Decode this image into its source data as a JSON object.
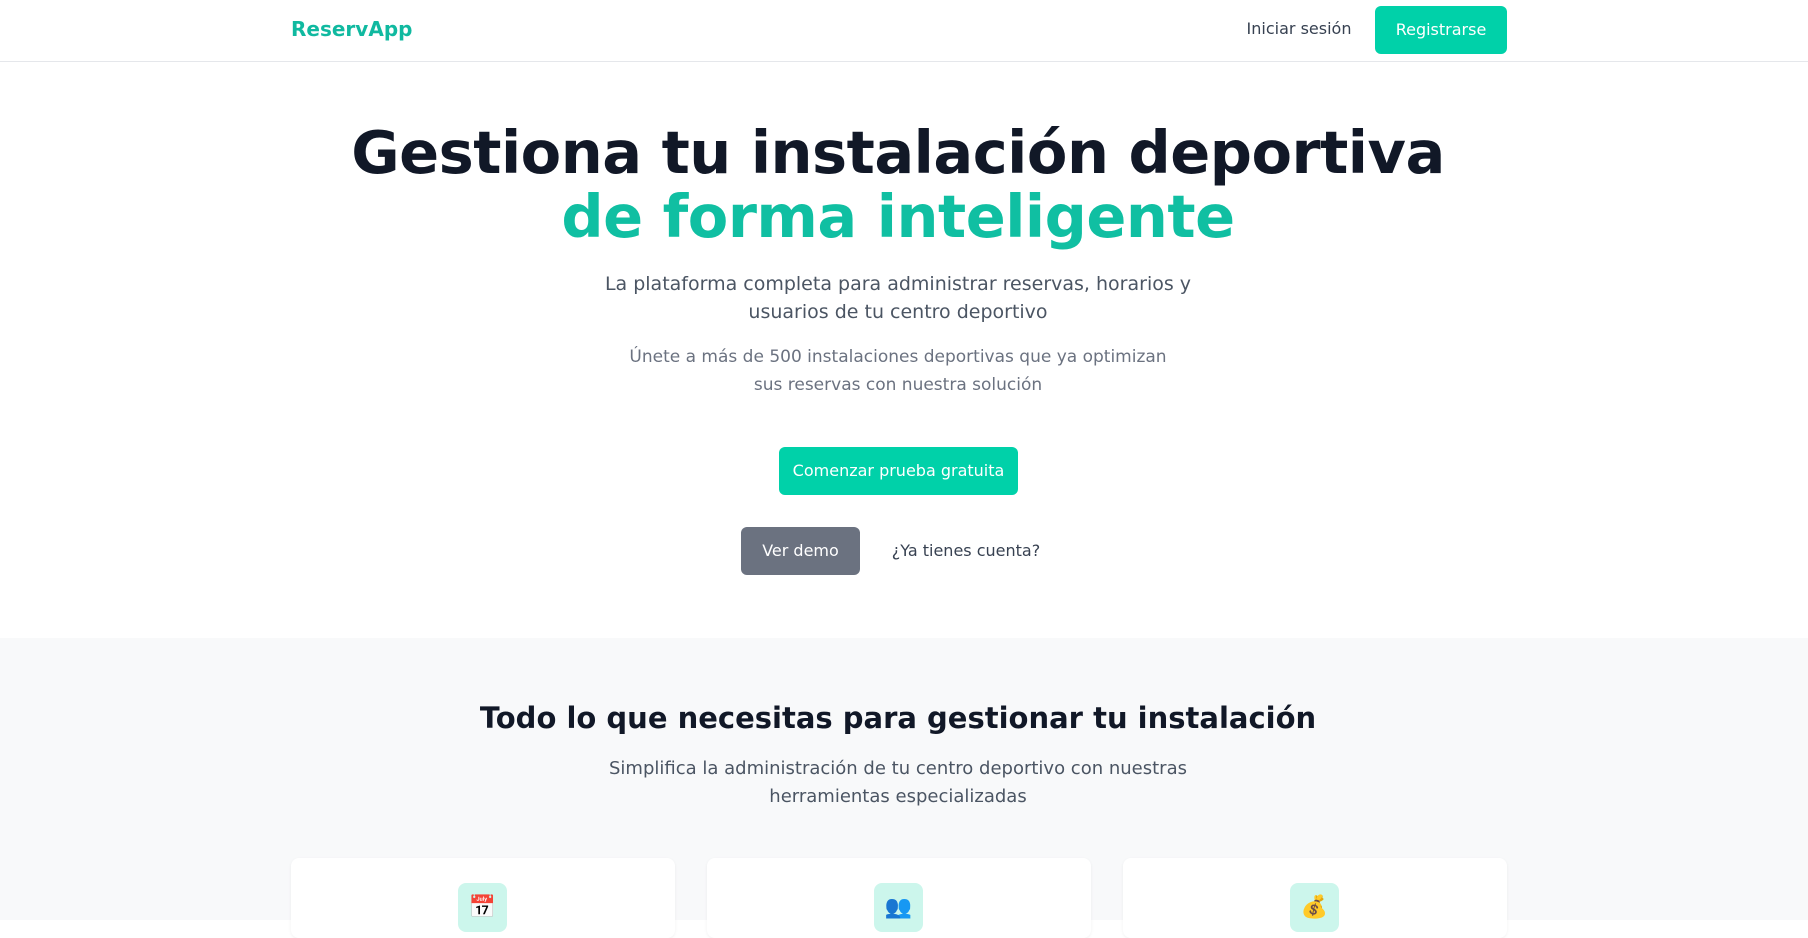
{
  "header": {
    "logo": "ReservApp",
    "login_label": "Iniciar sesión",
    "register_label": "Registrarse"
  },
  "hero": {
    "title_line1": "Gestiona tu instalación deportiva",
    "title_line2": "de forma inteligente",
    "subtitle": "La plataforma completa para administrar reservas, horarios y usuarios de tu centro deportivo",
    "note": "Únete a más de 500 instalaciones deportivas que ya optimizan sus reservas con nuestra solución",
    "cta_primary": "Comenzar prueba gratuita",
    "cta_demo": "Ver demo",
    "cta_account": "¿Ya tienes cuenta?"
  },
  "features": {
    "title": "Todo lo que necesitas para gestionar tu instalación",
    "subtitle": "Simplifica la administración de tu centro deportivo con nuestras herramientas especializadas",
    "cards": [
      {
        "icon": "calendar-icon",
        "glyph": "📅"
      },
      {
        "icon": "users-icon",
        "glyph": "👥"
      },
      {
        "icon": "money-bag-icon",
        "glyph": "💰"
      }
    ]
  },
  "colors": {
    "accent": "#00d1a9",
    "accent_text": "#10bfa2",
    "demo_button": "#6b7280",
    "section_bg": "#f8f9fa"
  }
}
